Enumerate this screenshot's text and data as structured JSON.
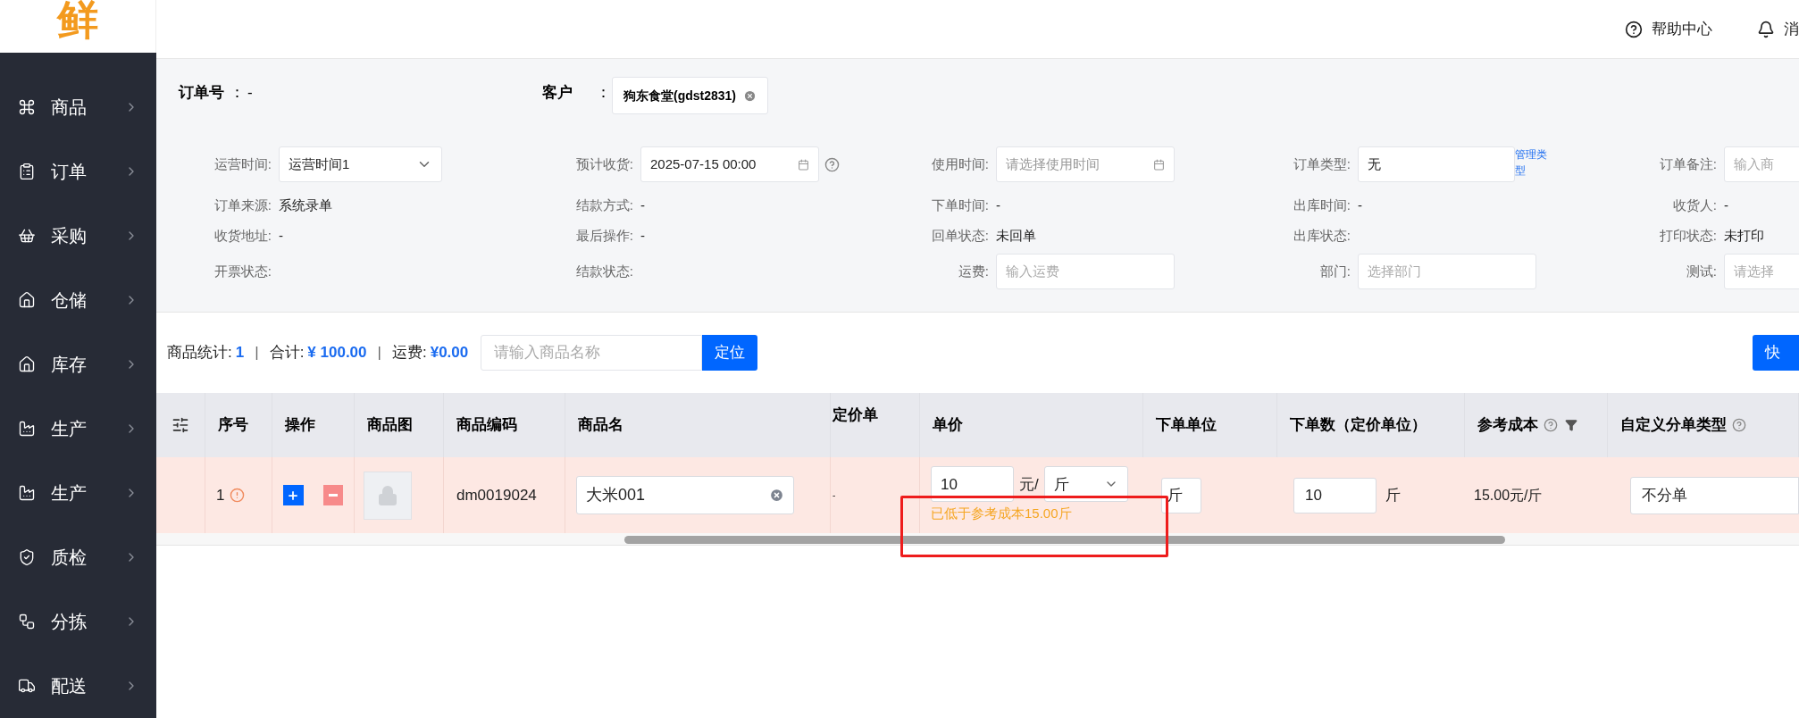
{
  "logo": {
    "text": "鲜"
  },
  "header": {
    "links": [
      {
        "label": "帮助中心",
        "kind": "help"
      },
      {
        "label": "消",
        "kind": "bell"
      }
    ]
  },
  "sidebar": {
    "items": [
      {
        "label": "商品"
      },
      {
        "label": "订单"
      },
      {
        "label": "采购"
      },
      {
        "label": "仓储"
      },
      {
        "label": "库存"
      },
      {
        "label": "生产"
      },
      {
        "label": "生产"
      },
      {
        "label": "质检"
      },
      {
        "label": "分拣"
      },
      {
        "label": "配送"
      }
    ]
  },
  "order": {
    "number_label": "订单号",
    "colon": "：",
    "number_value": "-",
    "customer_label": "客户",
    "customer_tag": "狗东食堂(gdst2831)"
  },
  "fields": [
    [
      {
        "label": "运营时间:",
        "kind": "select",
        "value": "运营时间1"
      },
      {
        "label": "预计收货:",
        "kind": "date",
        "value": "2025-07-15 00:00",
        "help": true
      },
      {
        "label": "使用时间:",
        "kind": "date",
        "placeholder": "请选择使用时间"
      },
      {
        "label": "订单类型:",
        "kind": "input",
        "value": "无",
        "link": "管理类型"
      },
      {
        "label": "订单备注:",
        "kind": "input",
        "placeholder": "输入商"
      }
    ],
    [
      {
        "label": "订单来源:",
        "kind": "text",
        "value": "系统录单"
      },
      {
        "label": "结款方式:",
        "kind": "text",
        "value": "-"
      },
      {
        "label": "下单时间:",
        "kind": "text",
        "value": "-"
      },
      {
        "label": "出库时间:",
        "kind": "text",
        "value": "-"
      },
      {
        "label": "收货人:",
        "kind": "text",
        "value": "-"
      }
    ],
    [
      {
        "label": "收货地址:",
        "kind": "text",
        "value": "-"
      },
      {
        "label": "最后操作:",
        "kind": "text",
        "value": "-"
      },
      {
        "label": "回单状态:",
        "kind": "text",
        "value": "未回单"
      },
      {
        "label": "出库状态:",
        "kind": "text"
      },
      {
        "label": "打印状态:",
        "kind": "text",
        "value": "未打印"
      }
    ],
    [
      {
        "label": "开票状态:",
        "kind": "text"
      },
      {
        "label": "结款状态:",
        "kind": "text"
      },
      {
        "label": "运费:",
        "kind": "input",
        "placeholder": "输入运费"
      },
      {
        "label": "部门:",
        "kind": "input",
        "placeholder": "选择部门"
      },
      {
        "label": "测试:",
        "kind": "input",
        "placeholder": "请选择"
      }
    ]
  ],
  "toolbar": {
    "stats": [
      {
        "label": "商品统计:",
        "value": "1"
      },
      {
        "label": "合计:",
        "value": "¥ 100.00"
      },
      {
        "label": "运费:",
        "value": "¥0.00"
      }
    ],
    "separator": "|",
    "search_placeholder": "请输入商品名称",
    "locate_button": "定位",
    "quick_button": "快"
  },
  "table": {
    "columns": [
      {
        "kind": "settings"
      },
      {
        "label": "序号"
      },
      {
        "label": "操作"
      },
      {
        "label": "商品图"
      },
      {
        "label": "商品编码"
      },
      {
        "label": "商品名"
      },
      {
        "label": "定价单"
      },
      {
        "label": "单价"
      },
      {
        "label": "下单单位"
      },
      {
        "label": "下单数（定价单位）"
      },
      {
        "label": "参考成本",
        "help": true,
        "filter": true
      },
      {
        "label": "自定义分单类型",
        "help": true
      }
    ],
    "rows": [
      {
        "index": "1",
        "warning": true,
        "code": "dm0019024",
        "name": "大米001",
        "pricing_unit": "-",
        "price": "10",
        "price_sep": "元/",
        "price_unit": "斤",
        "price_hint": "已低于参考成本15.00斤",
        "order_unit": "斤",
        "qty": "10",
        "qty_unit": "斤",
        "ref_cost": "15.00元/斤",
        "split_type": "不分单"
      }
    ]
  }
}
